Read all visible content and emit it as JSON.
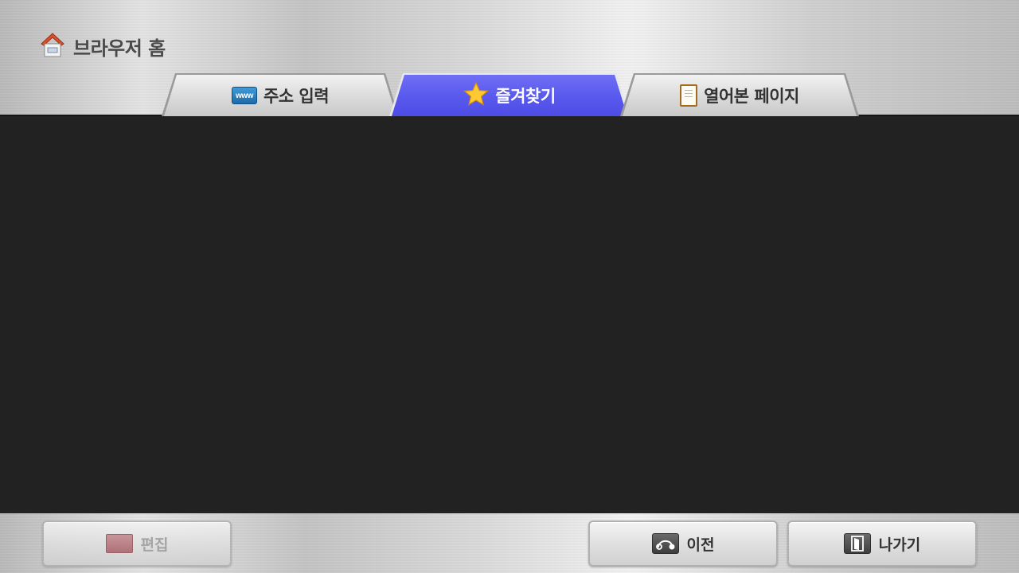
{
  "header": {
    "title": "브라우저 홈",
    "title_icon": "home-icon"
  },
  "tabs": [
    {
      "label": "주소 입력",
      "icon": "www-icon",
      "active": false
    },
    {
      "label": "즐겨찾기",
      "icon": "star-icon",
      "active": true
    },
    {
      "label": "열어본 페이지",
      "icon": "document-icon",
      "active": false
    }
  ],
  "footer": {
    "edit_label": "편집",
    "edit_enabled": false,
    "prev_label": "이전",
    "exit_label": "나가기"
  },
  "icons": {
    "www_text": "www"
  },
  "colors": {
    "active_tab": "#5a5aee",
    "content_background": "#222222",
    "edit_swatch": "#a85f66"
  }
}
